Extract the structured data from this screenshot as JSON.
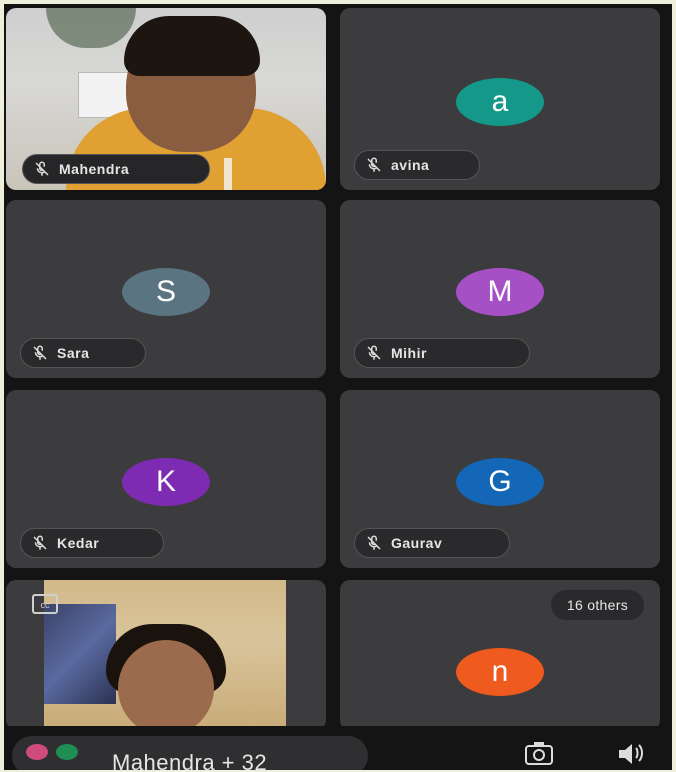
{
  "participants": [
    {
      "name": "Mahendra",
      "type": "video"
    },
    {
      "name": "avina",
      "type": "avatar",
      "initial": "a",
      "color": "#14988a"
    },
    {
      "name": "Sara",
      "type": "avatar",
      "initial": "S",
      "color": "#5a7482"
    },
    {
      "name": "Mihir",
      "type": "avatar",
      "initial": "M",
      "color": "#a650c6"
    },
    {
      "name": "Kedar",
      "type": "avatar",
      "initial": "K",
      "color": "#7e2bb4"
    },
    {
      "name": "Gaurav",
      "type": "avatar",
      "initial": "G",
      "color": "#1466b6"
    },
    {
      "name": "",
      "type": "video"
    },
    {
      "name": "",
      "type": "avatar",
      "initial": "n",
      "color": "#ef5a1e"
    }
  ],
  "others_label": "16 others",
  "bottom_bar": {
    "presenter_label": "Mahendra + 32"
  },
  "icons": {
    "mic": "mic-off-icon",
    "captions": "closed-captions-icon",
    "camera": "camera-flip-icon",
    "audio": "audio-output-icon"
  },
  "colors": {
    "tile_bg": "#3c3c3e",
    "app_bg": "#141414"
  }
}
